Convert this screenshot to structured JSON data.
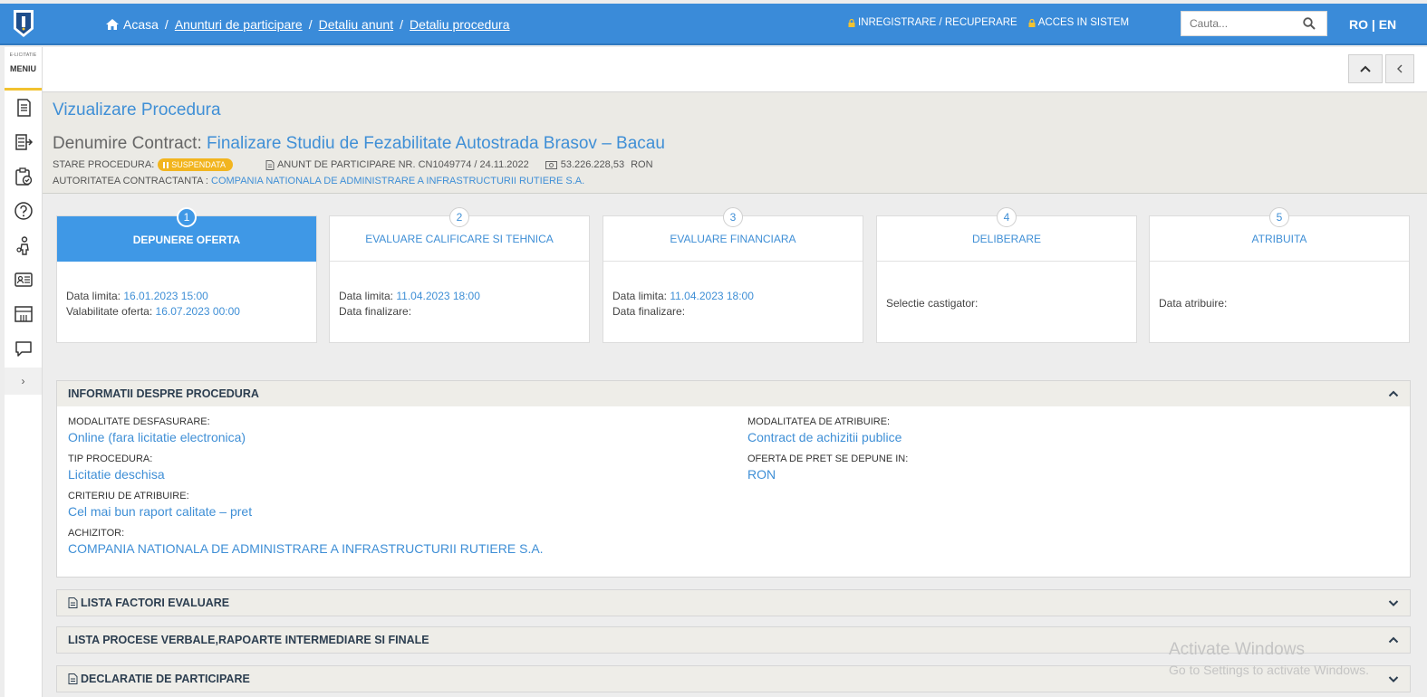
{
  "topbar": {
    "breadcrumbs": {
      "home": "Acasa",
      "items": [
        "Anunturi de participare",
        "Detaliu anunt",
        "Detaliu procedura"
      ]
    },
    "register_label": "INREGISTRARE / RECUPERARE",
    "login_label": "ACCES IN SISTEM",
    "search_placeholder": "Cauta...",
    "lang": "RO | EN"
  },
  "sidebar": {
    "small_label": "E-LICITATIE",
    "menu_label": "MENIU",
    "items": [
      "document-icon",
      "list-arrow-icon",
      "clipboard-check-icon",
      "help-icon",
      "person-icon",
      "id-card-icon",
      "archive-icon",
      "chat-icon"
    ],
    "toggle": "›"
  },
  "header": {
    "page_title": "Vizualizare Procedura",
    "contract_label": "Denumire Contract:",
    "contract_name": "Finalizare Studiu de Fezabilitate Autostrada Brasov – Bacau",
    "state_label": "STARE PROCEDURA:",
    "state_badge": "SUSPENDATA",
    "notice": "ANUNT DE PARTICIPARE NR. CN1049774 / 24.11.2022",
    "value": "53.226.228,53",
    "currency": "RON",
    "authority_label": "AUTORITATEA CONTRACTANTA :",
    "authority_name": "COMPANIA NATIONALA DE ADMINISTRARE A INFRASTRUCTURII RUTIERE S.A."
  },
  "steps": [
    {
      "num": "1",
      "title": "DEPUNERE OFERTA",
      "l1": "Data limita:",
      "v1": "16.01.2023 15:00",
      "l2": "Valabilitate oferta:",
      "v2": "16.07.2023 00:00"
    },
    {
      "num": "2",
      "title": "EVALUARE CALIFICARE SI TEHNICA",
      "l1": "Data limita:",
      "v1": "11.04.2023 18:00",
      "l2": "Data finalizare:",
      "v2": ""
    },
    {
      "num": "3",
      "title": "EVALUARE FINANCIARA",
      "l1": "Data limita:",
      "v1": "11.04.2023 18:00",
      "l2": "Data finalizare:",
      "v2": ""
    },
    {
      "num": "4",
      "title": "DELIBERARE",
      "l1": "Selectie castigator:"
    },
    {
      "num": "5",
      "title": "ATRIBUITA",
      "l1": "Data atribuire:"
    }
  ],
  "info": {
    "title": "INFORMATII DESPRE PROCEDURA",
    "fields": {
      "mod_desf_label": "MODALITATE DESFASURARE:",
      "mod_desf_value": "Online (fara licitatie electronica)",
      "tip_label": "TIP PROCEDURA:",
      "tip_value": "Licitatie deschisa",
      "crit_label": "CRITERIU DE ATRIBUIRE:",
      "crit_value": "Cel mai bun raport calitate – pret",
      "achiz_label": "ACHIZITOR:",
      "achiz_value": "COMPANIA NATIONALA DE ADMINISTRARE A INFRASTRUCTURII RUTIERE S.A.",
      "mod_atr_label": "MODALITATEA DE ATRIBUIRE:",
      "mod_atr_value": "Contract de achizitii publice",
      "oferta_label": "OFERTA DE PRET SE DEPUNE IN:",
      "oferta_value": "RON"
    }
  },
  "sections": {
    "factori": "LISTA FACTORI EVALUARE",
    "procese": "LISTA PROCESE VERBALE,RAPOARTE INTERMEDIARE SI FINALE",
    "declaratie": "DECLARATIE DE PARTICIPARE"
  },
  "watermark": {
    "line1": "Activate Windows",
    "line2": "Go to Settings to activate Windows."
  }
}
